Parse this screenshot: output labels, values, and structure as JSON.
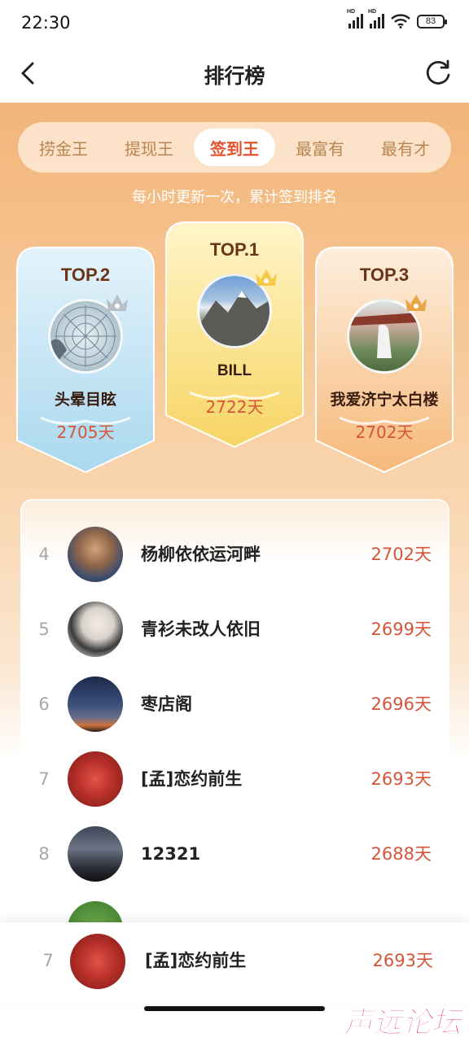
{
  "status_bar": {
    "time": "22:30",
    "battery": "83"
  },
  "header": {
    "title": "排行榜"
  },
  "tabs": [
    {
      "label": "捞金王",
      "active": false
    },
    {
      "label": "提现王",
      "active": false
    },
    {
      "label": "签到王",
      "active": true
    },
    {
      "label": "最富有",
      "active": false
    },
    {
      "label": "最有才",
      "active": false
    }
  ],
  "subtitle": "每小时更新一次，累计签到排名",
  "podium": {
    "first": {
      "rank": "TOP.1",
      "name": "BILL",
      "days": "2722天"
    },
    "second": {
      "rank": "TOP.2",
      "name": "头晕目眩",
      "days": "2705天"
    },
    "third": {
      "rank": "TOP.3",
      "name": "我爱济宁太白楼",
      "days": "2702天"
    }
  },
  "ranking": [
    {
      "rank": "4",
      "name": "杨柳依依运河畔",
      "days": "2702天"
    },
    {
      "rank": "5",
      "name": "青衫未改人依旧",
      "days": "2699天"
    },
    {
      "rank": "6",
      "name": "枣店阁",
      "days": "2696天"
    },
    {
      "rank": "7",
      "name": "[孟]恋约前生",
      "days": "2693天"
    },
    {
      "rank": "8",
      "name": "12321",
      "days": "2688天"
    }
  ],
  "my_rank": {
    "rank": "7",
    "name": "[孟]恋约前生",
    "days": "2693天"
  },
  "watermark": "声远论坛",
  "colors": {
    "accent": "#e4522c",
    "days": "#d4563a",
    "gold": "#f6c94a"
  }
}
